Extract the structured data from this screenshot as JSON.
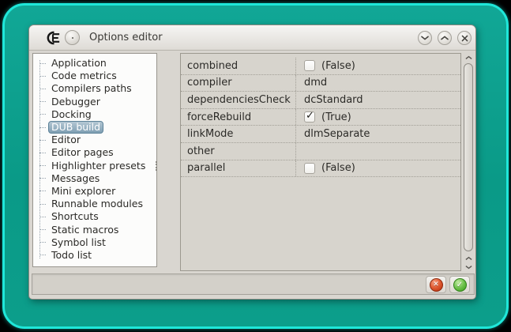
{
  "colors": {
    "backdrop_teal": "#0c9e8b",
    "backdrop_cyan_border": "#1fe7d9",
    "window_bg": "#d9d6d0",
    "selection_blue": "#7f9fb3",
    "cancel_red": "#d9492c",
    "ok_green": "#58b83e"
  },
  "icons": {
    "check_glyph": "✓",
    "close_glyph": "✕"
  },
  "titlebar": {
    "title": "Options editor",
    "buttons": [
      {
        "name": "roll-down",
        "icon": "chevron-down-icon"
      },
      {
        "name": "roll-up",
        "icon": "chevron-up-icon"
      },
      {
        "name": "close",
        "icon": "close-icon"
      }
    ]
  },
  "sidebar": {
    "items": [
      "Application",
      "Code metrics",
      "Compilers paths",
      "Debugger",
      "Docking",
      "DUB build",
      "Editor",
      "Editor pages",
      "Highlighter presets",
      "Messages",
      "Mini explorer",
      "Runnable modules",
      "Shortcuts",
      "Static macros",
      "Symbol list",
      "Todo list"
    ],
    "selected_index": 5,
    "selected_item": "DUB build"
  },
  "properties": {
    "rows": [
      {
        "name": "combined",
        "type": "checkbox",
        "checked": false,
        "display": "(False)"
      },
      {
        "name": "compiler",
        "type": "text",
        "display": "dmd"
      },
      {
        "name": "dependenciesCheck",
        "type": "text",
        "display": "dcStandard"
      },
      {
        "name": "forceRebuild",
        "type": "checkbox",
        "checked": true,
        "display": "(True)"
      },
      {
        "name": "linkMode",
        "type": "text",
        "display": "dlmSeparate"
      },
      {
        "name": "other",
        "type": "text",
        "display": ""
      },
      {
        "name": "parallel",
        "type": "checkbox",
        "checked": false,
        "display": "(False)"
      }
    ]
  },
  "footer": {
    "buttons": [
      {
        "name": "cancel",
        "icon": "cancel-icon"
      },
      {
        "name": "ok",
        "icon": "ok-icon"
      }
    ]
  }
}
